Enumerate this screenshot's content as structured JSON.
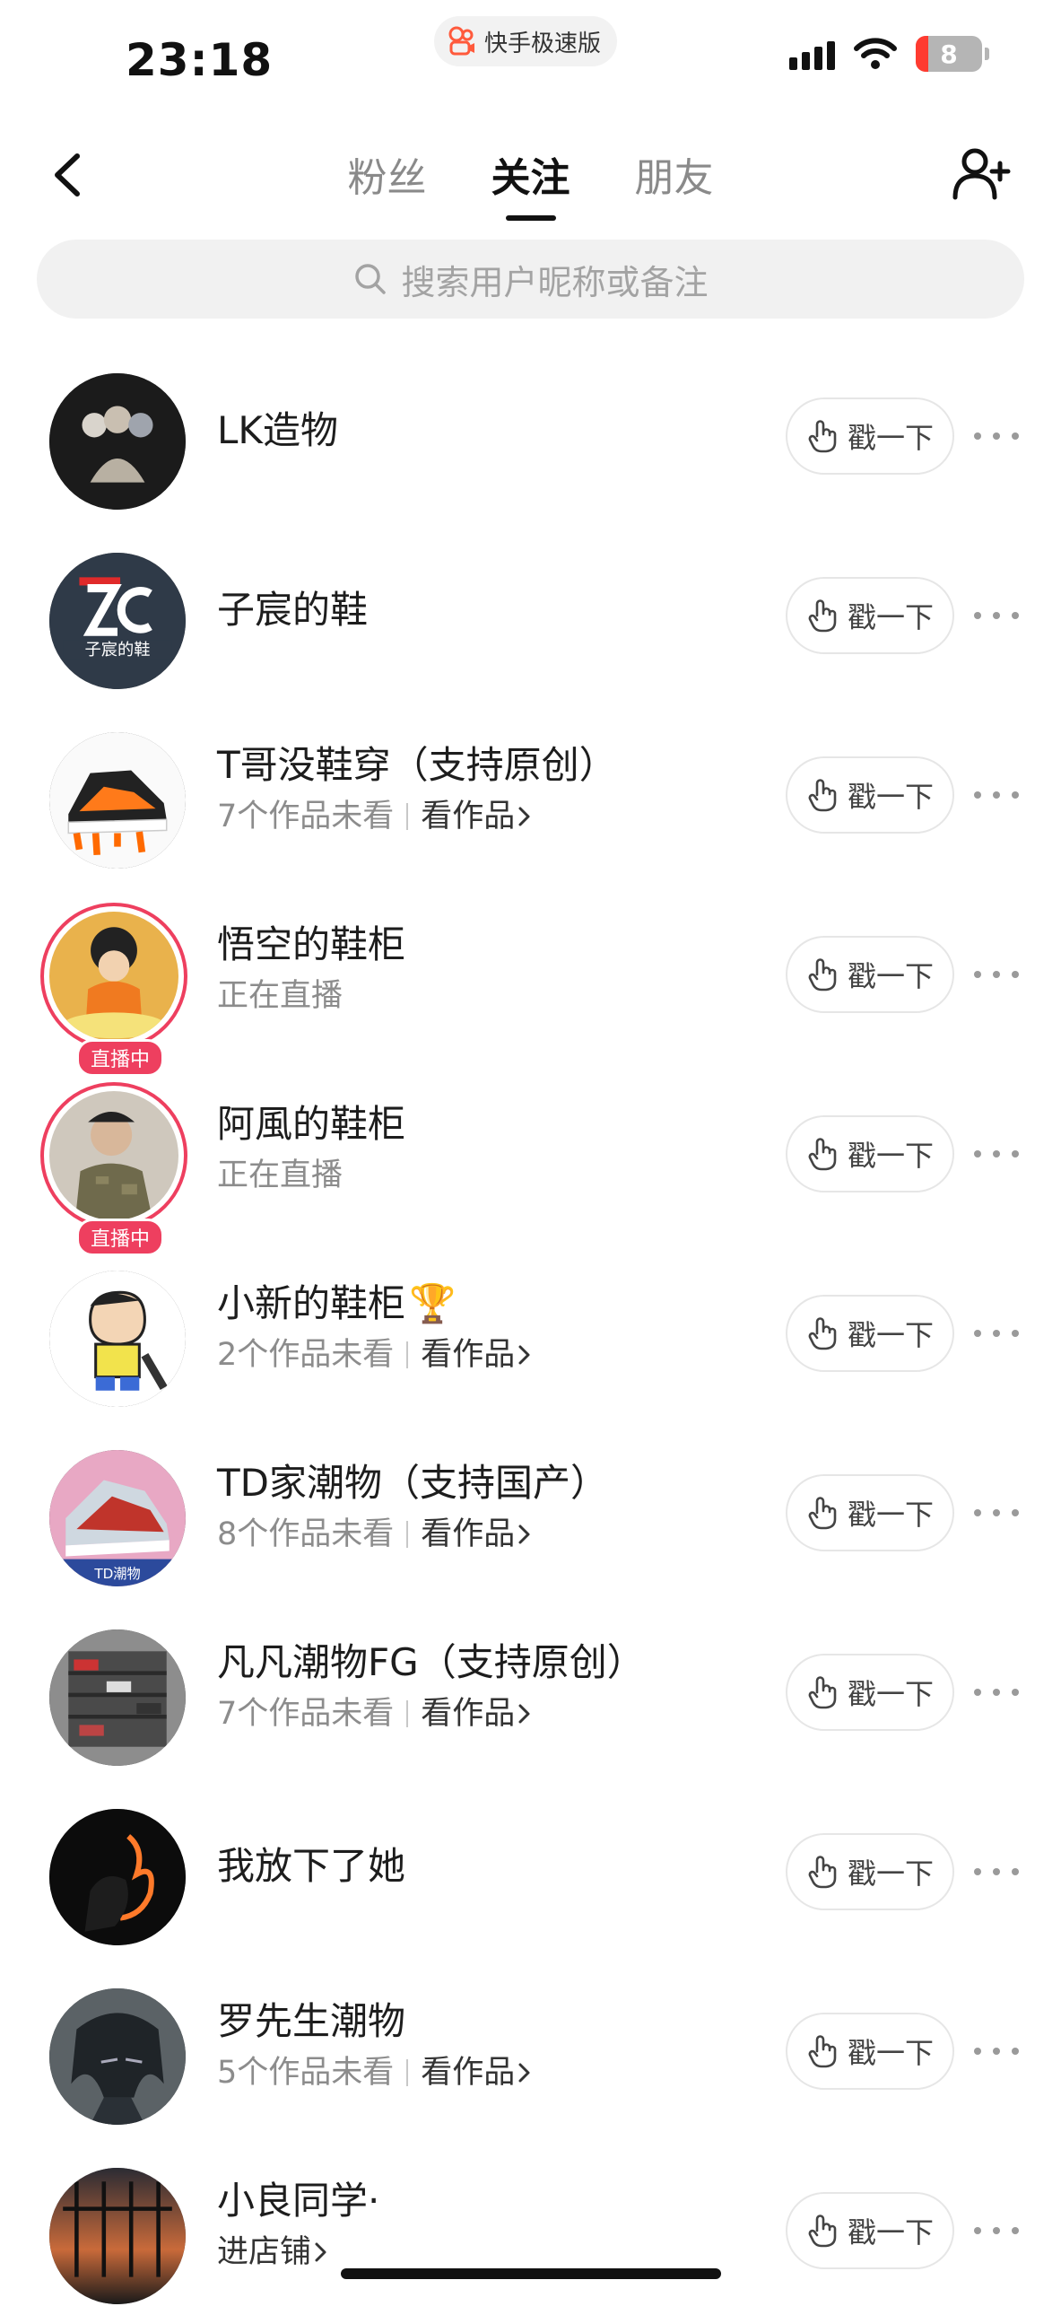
{
  "status_bar": {
    "time": "23:18",
    "app_name": "快手极速版",
    "battery": "8"
  },
  "nav": {
    "tabs": [
      {
        "label": "粉丝",
        "active": false
      },
      {
        "label": "关注",
        "active": true
      },
      {
        "label": "朋友",
        "active": false
      }
    ]
  },
  "search": {
    "placeholder": "搜索用户昵称或备注"
  },
  "poke_label": "戳一下",
  "follows": [
    {
      "name": "LK造物",
      "sub": "",
      "link": "",
      "live": false,
      "badge": "",
      "emoji": ""
    },
    {
      "name": "子宸的鞋",
      "sub": "",
      "link": "",
      "live": false,
      "badge": "",
      "emoji": ""
    },
    {
      "name": "T哥没鞋穿（支持原创）",
      "sub": "7个作品未看",
      "link": "看作品",
      "live": false,
      "badge": "",
      "emoji": ""
    },
    {
      "name": "悟空的鞋柜",
      "sub": "正在直播",
      "link": "",
      "live": true,
      "badge": "直播中",
      "emoji": ""
    },
    {
      "name": "阿風的鞋柜",
      "sub": "正在直播",
      "link": "",
      "live": true,
      "badge": "直播中",
      "emoji": ""
    },
    {
      "name": "小新的鞋柜",
      "sub": "2个作品未看",
      "link": "看作品",
      "live": false,
      "badge": "",
      "emoji": "🏆"
    },
    {
      "name": "TD家潮物（支持国产）",
      "sub": "8个作品未看",
      "link": "看作品",
      "live": false,
      "badge": "",
      "emoji": ""
    },
    {
      "name": "凡凡潮物FG（支持原创）",
      "sub": "7个作品未看",
      "link": "看作品",
      "live": false,
      "badge": "",
      "emoji": ""
    },
    {
      "name": "我放下了她",
      "sub": "",
      "link": "",
      "live": false,
      "badge": "",
      "emoji": ""
    },
    {
      "name": "罗先生潮物",
      "sub": "5个作品未看",
      "link": "看作品",
      "live": false,
      "badge": "",
      "emoji": ""
    },
    {
      "name": "小良同学·",
      "sub": "",
      "link": "进店铺",
      "live": false,
      "badge": "",
      "emoji": ""
    }
  ],
  "colors": {
    "live_ring": "#ee3f5f",
    "active_tab": "#111111",
    "inactive_tab": "#8a8a8a"
  }
}
